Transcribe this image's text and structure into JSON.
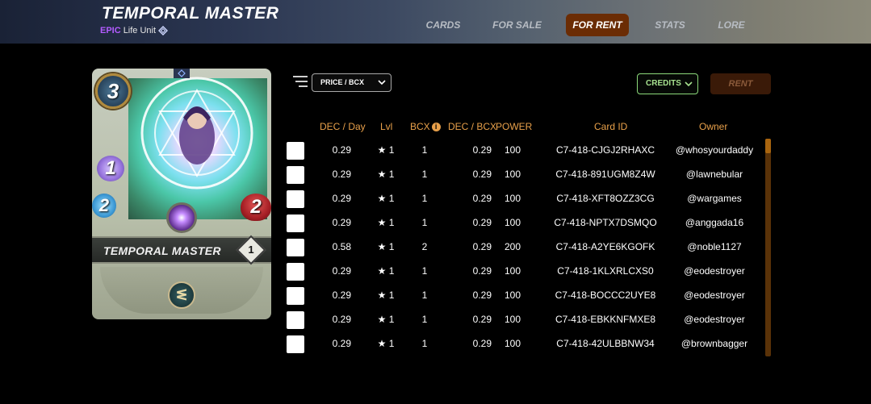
{
  "header": {
    "title": "TEMPORAL MASTER",
    "rarity": "EPIC",
    "unit_type": "Life Unit",
    "nav": [
      {
        "label": "CARDS",
        "active": false
      },
      {
        "label": "FOR SALE",
        "active": false
      },
      {
        "label": "FOR RENT",
        "active": true
      },
      {
        "label": "STATS",
        "active": false
      },
      {
        "label": "LORE",
        "active": false
      }
    ]
  },
  "card": {
    "name": "TEMPORAL MASTER",
    "mana": "3",
    "magic": "1",
    "speed": "2",
    "health": "2",
    "level": "1"
  },
  "toolbar": {
    "sort_label": "PRICE / BCX",
    "currency_label": "CREDITS",
    "rent_label": "RENT"
  },
  "table": {
    "headers": {
      "dec_day": "DEC / Day",
      "lvl": "Lvl",
      "bcx": "BCX",
      "dec_bcx": "DEC / BCX",
      "power": "POWER",
      "card_id": "Card ID",
      "owner": "Owner"
    },
    "rows": [
      {
        "dec_day": "0.29",
        "lvl": "★ 1",
        "bcx": "1",
        "dec_bcx": "0.29",
        "power": "100",
        "card_id": "C7-418-CJGJ2RHAXC",
        "owner": "@whosyourdaddy"
      },
      {
        "dec_day": "0.29",
        "lvl": "★ 1",
        "bcx": "1",
        "dec_bcx": "0.29",
        "power": "100",
        "card_id": "C7-418-891UGM8Z4W",
        "owner": "@lawnebular"
      },
      {
        "dec_day": "0.29",
        "lvl": "★ 1",
        "bcx": "1",
        "dec_bcx": "0.29",
        "power": "100",
        "card_id": "C7-418-XFT8OZZ3CG",
        "owner": "@wargames"
      },
      {
        "dec_day": "0.29",
        "lvl": "★ 1",
        "bcx": "1",
        "dec_bcx": "0.29",
        "power": "100",
        "card_id": "C7-418-NPTX7DSMQO",
        "owner": "@anggada16"
      },
      {
        "dec_day": "0.58",
        "lvl": "★ 1",
        "bcx": "2",
        "dec_bcx": "0.29",
        "power": "200",
        "card_id": "C7-418-A2YE6KGOFK",
        "owner": "@noble1127"
      },
      {
        "dec_day": "0.29",
        "lvl": "★ 1",
        "bcx": "1",
        "dec_bcx": "0.29",
        "power": "100",
        "card_id": "C7-418-1KLXRLCXS0",
        "owner": "@eodestroyer"
      },
      {
        "dec_day": "0.29",
        "lvl": "★ 1",
        "bcx": "1",
        "dec_bcx": "0.29",
        "power": "100",
        "card_id": "C7-418-BOCCC2UYE8",
        "owner": "@eodestroyer"
      },
      {
        "dec_day": "0.29",
        "lvl": "★ 1",
        "bcx": "1",
        "dec_bcx": "0.29",
        "power": "100",
        "card_id": "C7-418-EBKKNFMXE8",
        "owner": "@eodestroyer"
      },
      {
        "dec_day": "0.29",
        "lvl": "★ 1",
        "bcx": "1",
        "dec_bcx": "0.29",
        "power": "100",
        "card_id": "C7-418-42ULBBNW34",
        "owner": "@brownbagger"
      }
    ]
  },
  "colors": {
    "accent_orange": "#e8a04a",
    "active_tab": "#6b2c04",
    "credits_green": "#a7e28f",
    "rarity_epic": "#b35cff"
  },
  "icons": [
    "life-icon",
    "filter-icon",
    "chevron-down-icon",
    "info-icon",
    "ability-icon"
  ]
}
